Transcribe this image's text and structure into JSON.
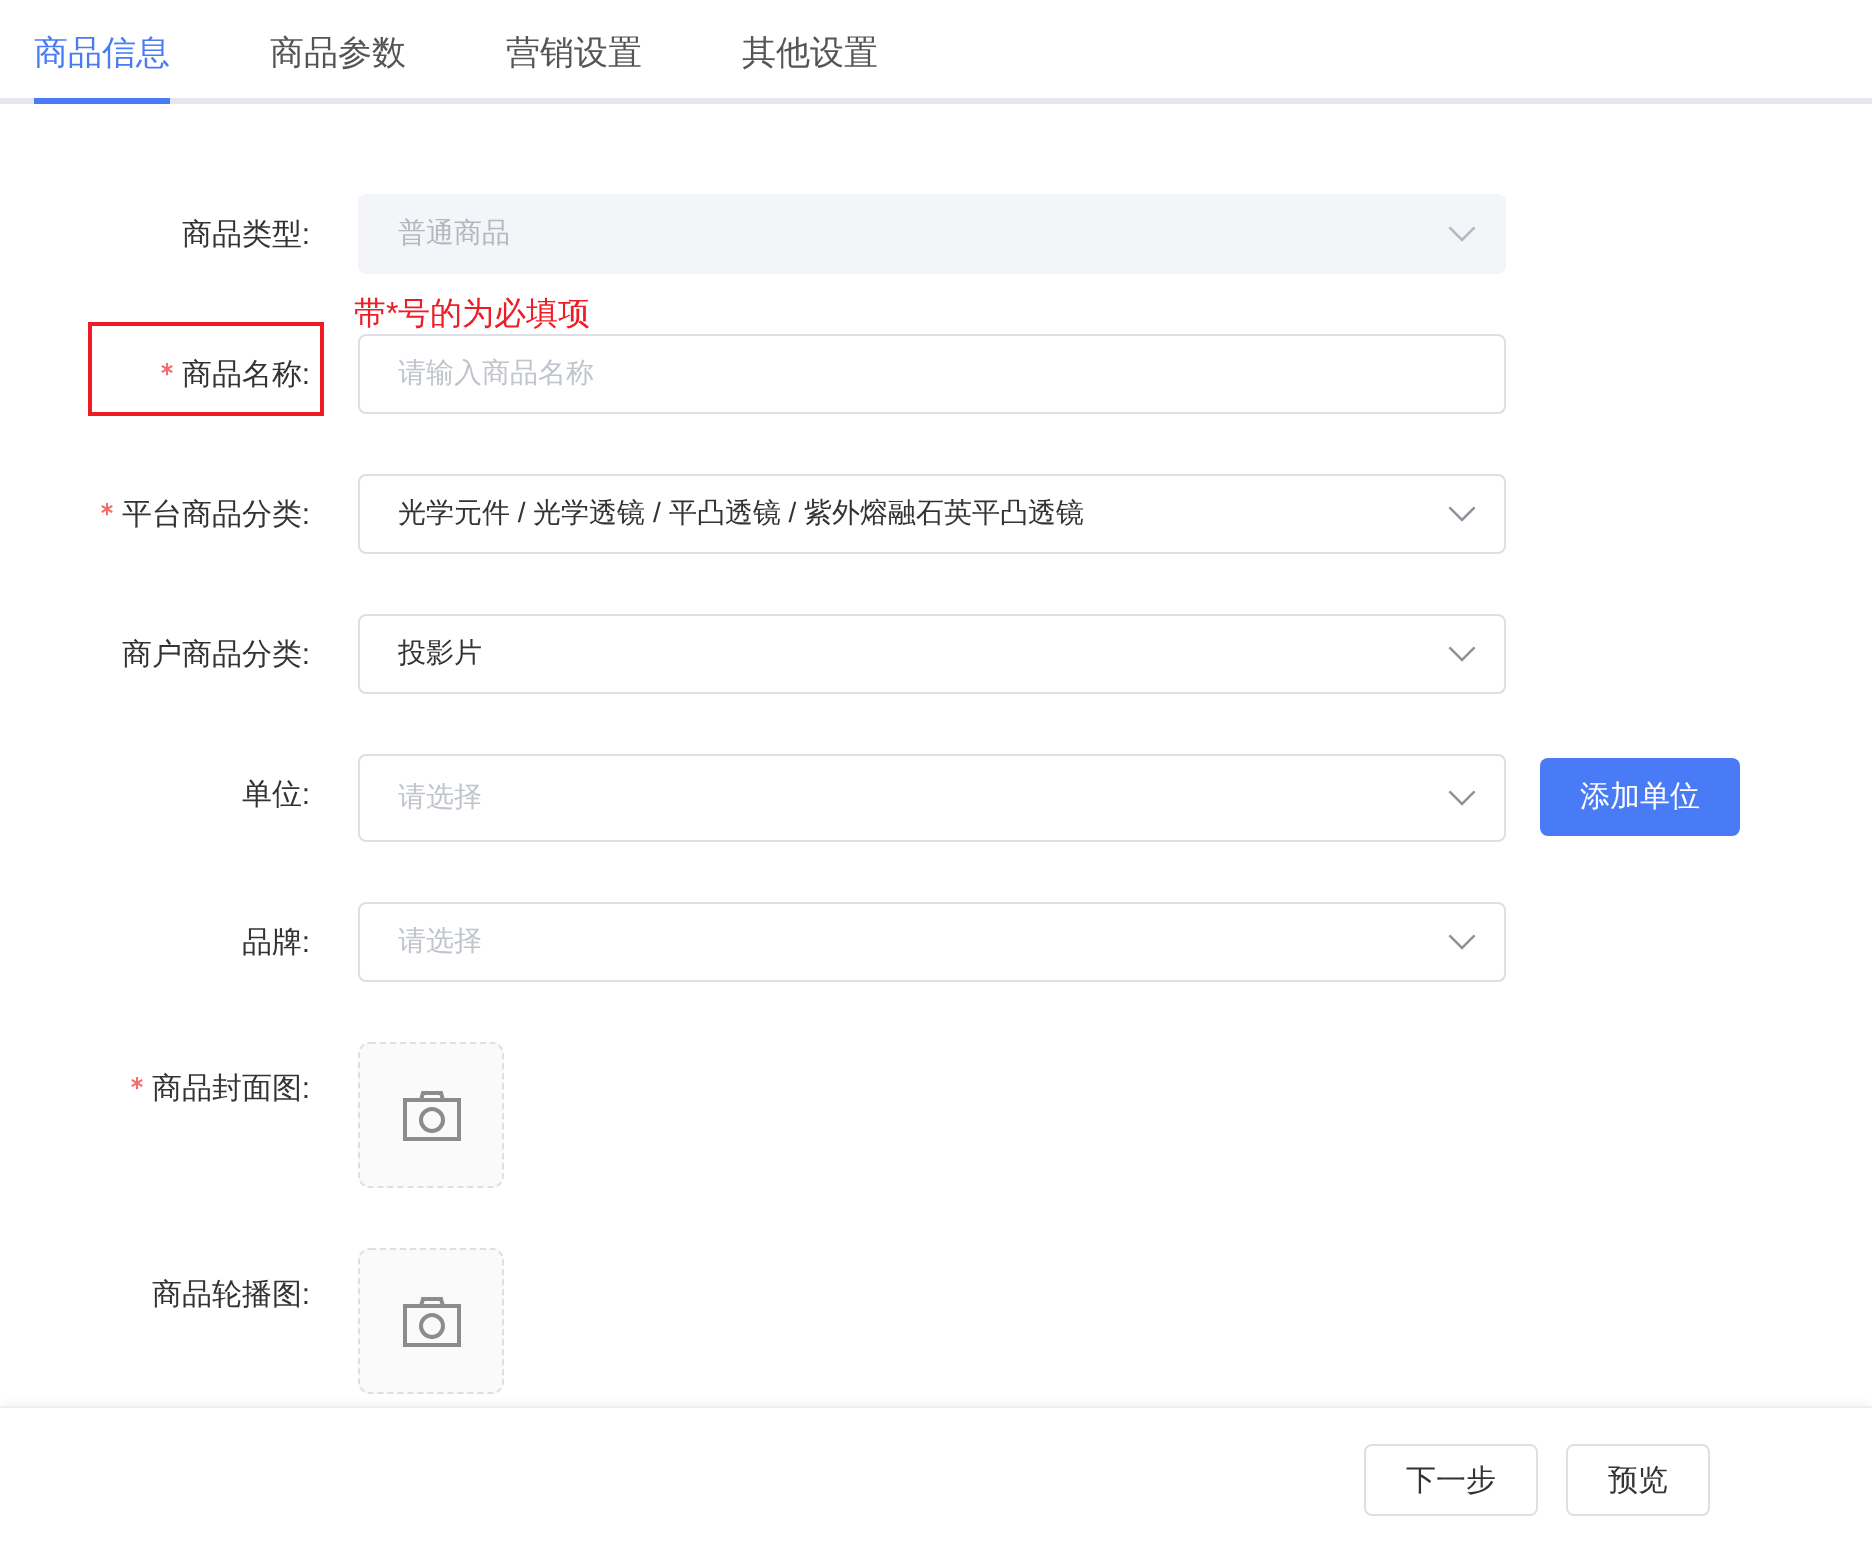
{
  "tabs": [
    {
      "label": "商品信息",
      "selected": true
    },
    {
      "label": "商品参数",
      "selected": false
    },
    {
      "label": "营销设置",
      "selected": false
    },
    {
      "label": "其他设置",
      "selected": false
    }
  ],
  "form": {
    "fields": [
      {
        "kind": "select",
        "label": "商品类型:",
        "required": false,
        "disabled": true,
        "value": "普通商品"
      },
      {
        "kind": "input",
        "label": "商品名称:",
        "required": true,
        "disabled": false,
        "placeholder": "请输入商品名称",
        "annotation": {
          "text": "带*号的为必填项",
          "boxed": true
        }
      },
      {
        "kind": "select",
        "label": "平台商品分类:",
        "required": true,
        "disabled": false,
        "value": "光学元件 / 光学透镜 / 平凸透镜 / 紫外熔融石英平凸透镜"
      },
      {
        "kind": "select",
        "label": "商户商品分类:",
        "required": false,
        "disabled": false,
        "value": "投影片"
      },
      {
        "kind": "select",
        "label": "单位:",
        "required": false,
        "disabled": false,
        "placeholder": "请选择",
        "button": "添加单位"
      },
      {
        "kind": "select",
        "label": "品牌:",
        "required": false,
        "disabled": false,
        "placeholder": "请选择"
      },
      {
        "kind": "upload",
        "label": "商品封面图:",
        "required": true,
        "disabled": false
      },
      {
        "kind": "upload",
        "label": "商品轮播图:",
        "required": false,
        "disabled": false
      }
    ]
  },
  "footer": {
    "buttons": [
      "下一步",
      "预览"
    ]
  }
}
